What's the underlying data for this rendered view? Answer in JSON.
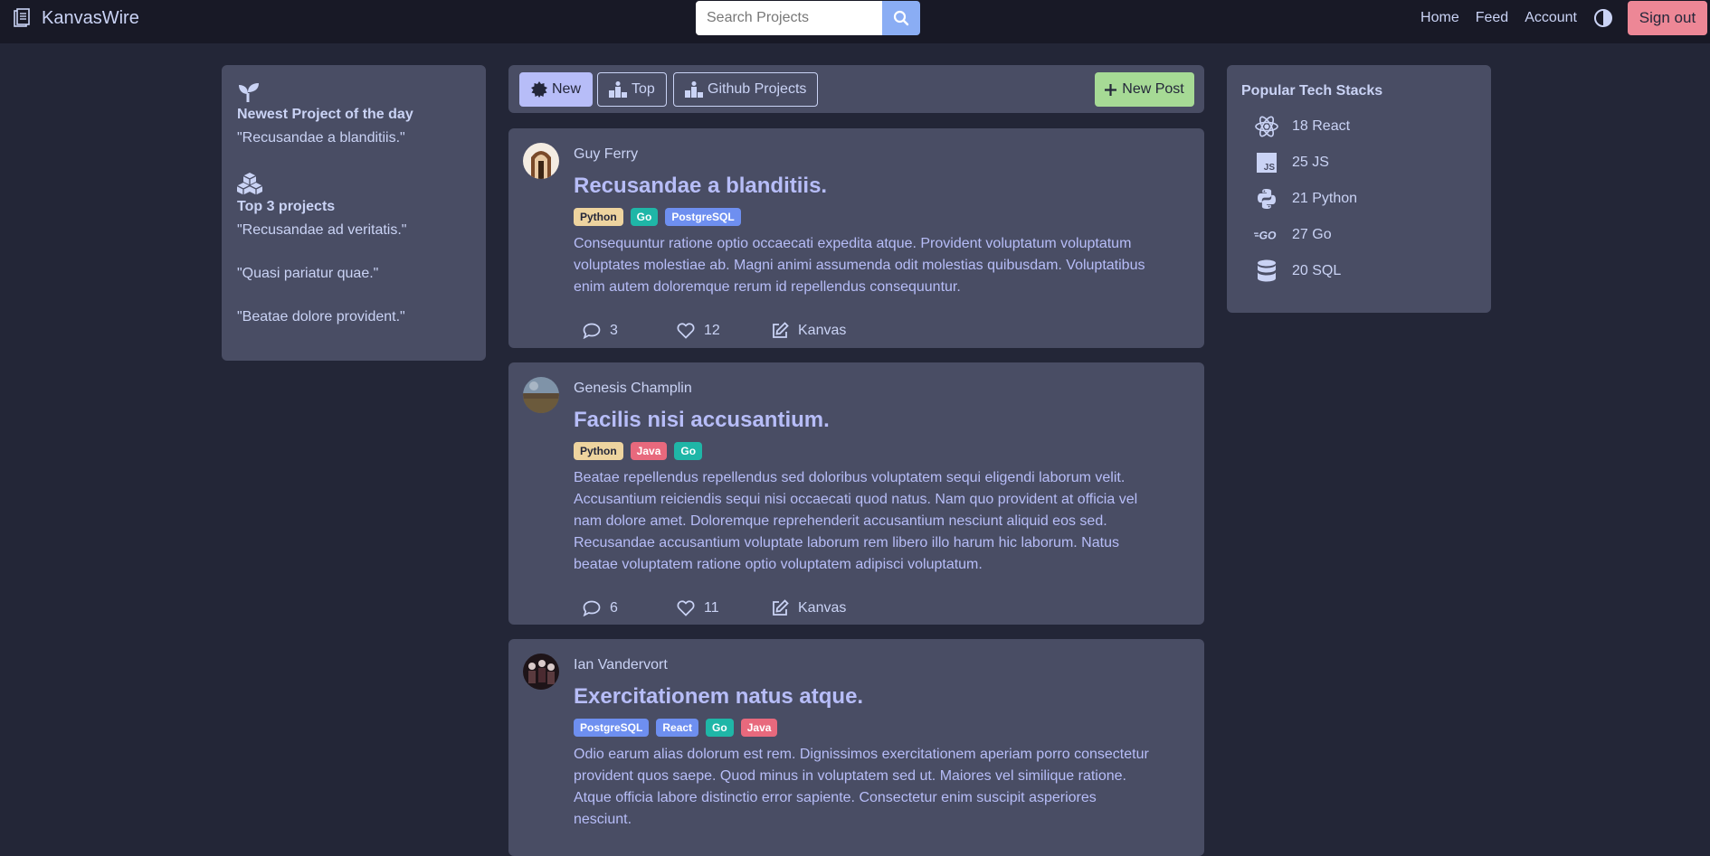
{
  "navbar": {
    "brand": "KanvasWire",
    "search_placeholder": "Search Projects",
    "links": [
      "Home",
      "Feed",
      "Account"
    ],
    "signout": "Sign out"
  },
  "left": {
    "newest_title": "Newest Project of the day",
    "newest_project": "\"Recusandae a blanditiis.\"",
    "top_title": "Top 3 projects",
    "top_projects": [
      "\"Recusandae ad veritatis.\"",
      "\"Quasi pariatur quae.\"",
      "\"Beatae dolore provident.\""
    ]
  },
  "filters": {
    "new": "New",
    "top": "Top",
    "github": "Github Projects",
    "new_post": "New Post"
  },
  "posts": [
    {
      "author": "Guy Ferry",
      "title": "Recusandae a blanditiis.",
      "tags": [
        {
          "label": "Python",
          "color": "#eed49f"
        },
        {
          "label": "Go",
          "color": "#1fb6a7"
        },
        {
          "label": "PostgreSQL",
          "color": "#6e8ff0"
        }
      ],
      "body": "Consequuntur ratione optio occaecati expedita atque. Provident voluptatum voluptatum voluptates molestiae ab. Magni animi assumenda odit molestias quibusdam. Voluptatibus enim autem doloremque rerum id repellendus consequuntur.",
      "comments": "3",
      "likes": "12",
      "editor": "Kanvas"
    },
    {
      "author": "Genesis Champlin",
      "title": "Facilis nisi accusantium.",
      "tags": [
        {
          "label": "Python",
          "color": "#eed49f"
        },
        {
          "label": "Java",
          "color": "#e8697d"
        },
        {
          "label": "Go",
          "color": "#1fb6a7"
        }
      ],
      "body": "Beatae repellendus repellendus sed doloribus voluptatem sequi eligendi laborum velit. Accusantium reiciendis sequi nisi occaecati quod natus. Nam quo provident at officia vel nam dolore amet. Doloremque reprehenderit accusantium nesciunt aliquid eos sed. Recusandae accusantium voluptate laborum rem libero illo harum hic laborum. Natus beatae voluptatem ratione optio voluptatem adipisci voluptatum.",
      "comments": "6",
      "likes": "11",
      "editor": "Kanvas"
    },
    {
      "author": "Ian Vandervort",
      "title": "Exercitationem natus atque.",
      "tags": [
        {
          "label": "PostgreSQL",
          "color": "#6e8ff0"
        },
        {
          "label": "React",
          "color": "#6e8ff0"
        },
        {
          "label": "Go",
          "color": "#1fb6a7"
        },
        {
          "label": "Java",
          "color": "#e8697d"
        }
      ],
      "body": "Odio earum alias dolorum est rem. Dignissimos exercitationem aperiam porro consectetur provident quos saepe. Quod minus in voluptatem sed ut. Maiores vel similique ratione. Atque officia labore distinctio error sapiente. Consectetur enim suscipit asperiores nesciunt."
    }
  ],
  "right": {
    "title": "Popular Tech Stacks",
    "stacks": [
      {
        "icon": "react-icon",
        "text": "18 React"
      },
      {
        "icon": "js-icon",
        "text": "25 JS"
      },
      {
        "icon": "python-icon",
        "text": "21 Python"
      },
      {
        "icon": "go-icon",
        "text": "27 Go"
      },
      {
        "icon": "database-icon",
        "text": "20 SQL"
      }
    ]
  }
}
